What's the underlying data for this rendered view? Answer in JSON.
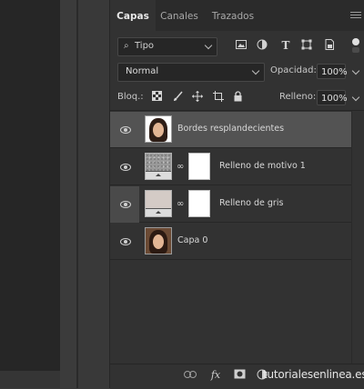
{
  "tabs": [
    "Capas",
    "Canales",
    "Trazados"
  ],
  "filter": {
    "kind_label": "Tipo",
    "search_glyph": "⌕"
  },
  "filter_icons": [
    "image-filter-icon",
    "adjustment-filter-icon",
    "type-filter-icon",
    "shape-filter-icon",
    "smart-object-filter-icon"
  ],
  "blend_mode": "Normal",
  "opacity": {
    "label": "Opacidad:",
    "value": "100%"
  },
  "lock": {
    "label": "Bloq.:"
  },
  "fill": {
    "label": "Relleno:",
    "value": "100%"
  },
  "layers": [
    {
      "name": "Bordes resplandecientes",
      "selected": true,
      "thumb": "portrait-white",
      "has_mask": false
    },
    {
      "name": "Relleno de motivo 1",
      "selected": false,
      "thumb": "pattern",
      "has_mask": true
    },
    {
      "name": "Relleno de gris",
      "selected": false,
      "thumb": "gray",
      "has_mask": true
    },
    {
      "name": "Capa 0",
      "selected": false,
      "thumb": "portrait",
      "has_mask": false
    }
  ],
  "footer": {
    "fx_label": "fx",
    "watermark": "tutorialesenlinea.es"
  },
  "colors": {
    "panel_bg": "#323232",
    "selected_layer": "#535353",
    "canvas_bg": "#262626"
  }
}
